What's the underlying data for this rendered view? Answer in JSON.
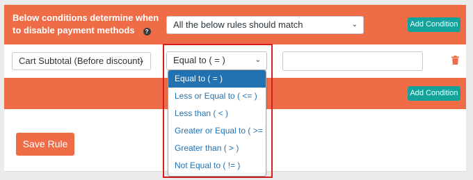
{
  "header": {
    "description": "Below conditions determine when to disable payment methods",
    "match_select_value": "All the below rules should match",
    "add_condition_label": "Add Condition",
    "help_glyph": "?"
  },
  "condition": {
    "field_value": "Cart Subtotal (Before discount)",
    "operator_value": "Equal to ( = )",
    "value_input": ""
  },
  "operator_dropdown": {
    "options": [
      "Equal to ( = )",
      "Less or Equal to ( <= )",
      "Less than ( < )",
      "Greater or Equal to ( >= )",
      "Greater than ( > )",
      "Not Equal to ( != )"
    ],
    "selected": "Equal to ( = )"
  },
  "group2": {
    "add_condition_label": "Add Condition"
  },
  "footer": {
    "save_label": "Save Rule"
  },
  "colors": {
    "accent": "#ef6c47",
    "teal": "#14a39a",
    "selected_option": "#2271b1",
    "highlight": "#d91d1d"
  },
  "icons": [
    "help-icon",
    "chevron-down-icon",
    "trash-icon"
  ]
}
